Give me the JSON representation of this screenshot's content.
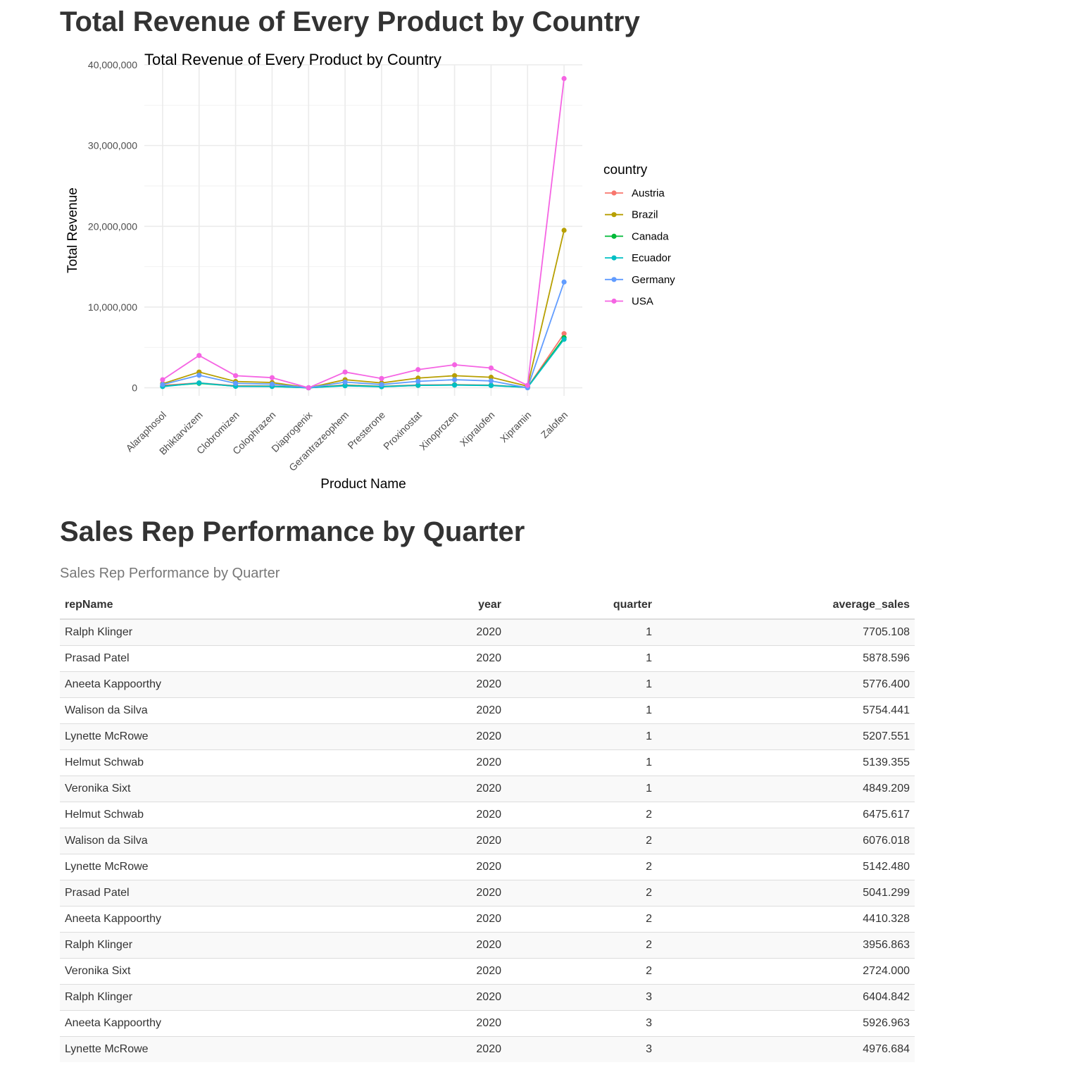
{
  "section1_title": "Total Revenue of Every Product by Country",
  "section2_title": "Sales Rep Performance by Quarter",
  "chart_data": {
    "type": "line",
    "title": "Total Revenue of Every Product by Country",
    "xlabel": "Product Name",
    "ylabel": "Total Revenue",
    "ylim": [
      -1000000,
      40000000
    ],
    "yticks": [
      0,
      10000000,
      20000000,
      30000000,
      40000000
    ],
    "ytick_labels": [
      "0",
      "10,000,000",
      "20,000,000",
      "30,000,000",
      "40,000,000"
    ],
    "grid": true,
    "legend_title": "country",
    "legend_position": "right",
    "categories": [
      "Alaraphosol",
      "Bhiktarvizem",
      "Clobromizen",
      "Colophrazen",
      "Diaprogenix",
      "Gerantrazeophem",
      "Presterone",
      "Proxinostat",
      "Xinoprozen",
      "Xipralofen",
      "Xipramin",
      "Zalofen"
    ],
    "series": [
      {
        "name": "Austria",
        "color": "#F8766D",
        "values": [
          300000,
          600000,
          250000,
          220000,
          0,
          350000,
          180000,
          350000,
          380000,
          330000,
          60000,
          6700000
        ]
      },
      {
        "name": "Brazil",
        "color": "#B79F00",
        "values": [
          500000,
          1950000,
          780000,
          650000,
          0,
          1000000,
          600000,
          1200000,
          1500000,
          1300000,
          200000,
          19500000
        ]
      },
      {
        "name": "Canada",
        "color": "#00BA38",
        "values": [
          200000,
          550000,
          200000,
          180000,
          0,
          300000,
          150000,
          300000,
          350000,
          300000,
          50000,
          6200000
        ]
      },
      {
        "name": "Ecuador",
        "color": "#00BFC4",
        "values": [
          150000,
          600000,
          180000,
          160000,
          0,
          250000,
          130000,
          300000,
          330000,
          280000,
          40000,
          6000000
        ]
      },
      {
        "name": "Germany",
        "color": "#619CFF",
        "values": [
          400000,
          1550000,
          550000,
          450000,
          0,
          700000,
          400000,
          800000,
          1000000,
          850000,
          0,
          13100000
        ]
      },
      {
        "name": "USA",
        "color": "#F564E3",
        "values": [
          1000000,
          4000000,
          1500000,
          1250000,
          0,
          1950000,
          1150000,
          2250000,
          2850000,
          2450000,
          300000,
          38300000
        ]
      }
    ]
  },
  "table": {
    "caption": "Sales Rep Performance by Quarter",
    "headers": {
      "repName": "repName",
      "year": "year",
      "quarter": "quarter",
      "average_sales": "average_sales"
    },
    "rows": [
      [
        "Ralph Klinger",
        "2020",
        "1",
        "7705.108"
      ],
      [
        "Prasad Patel",
        "2020",
        "1",
        "5878.596"
      ],
      [
        "Aneeta Kappoorthy",
        "2020",
        "1",
        "5776.400"
      ],
      [
        "Walison da Silva",
        "2020",
        "1",
        "5754.441"
      ],
      [
        "Lynette McRowe",
        "2020",
        "1",
        "5207.551"
      ],
      [
        "Helmut Schwab",
        "2020",
        "1",
        "5139.355"
      ],
      [
        "Veronika Sixt",
        "2020",
        "1",
        "4849.209"
      ],
      [
        "Helmut Schwab",
        "2020",
        "2",
        "6475.617"
      ],
      [
        "Walison da Silva",
        "2020",
        "2",
        "6076.018"
      ],
      [
        "Lynette McRowe",
        "2020",
        "2",
        "5142.480"
      ],
      [
        "Prasad Patel",
        "2020",
        "2",
        "5041.299"
      ],
      [
        "Aneeta Kappoorthy",
        "2020",
        "2",
        "4410.328"
      ],
      [
        "Ralph Klinger",
        "2020",
        "2",
        "3956.863"
      ],
      [
        "Veronika Sixt",
        "2020",
        "2",
        "2724.000"
      ],
      [
        "Ralph Klinger",
        "2020",
        "3",
        "6404.842"
      ],
      [
        "Aneeta Kappoorthy",
        "2020",
        "3",
        "5926.963"
      ],
      [
        "Lynette McRowe",
        "2020",
        "3",
        "4976.684"
      ]
    ]
  }
}
